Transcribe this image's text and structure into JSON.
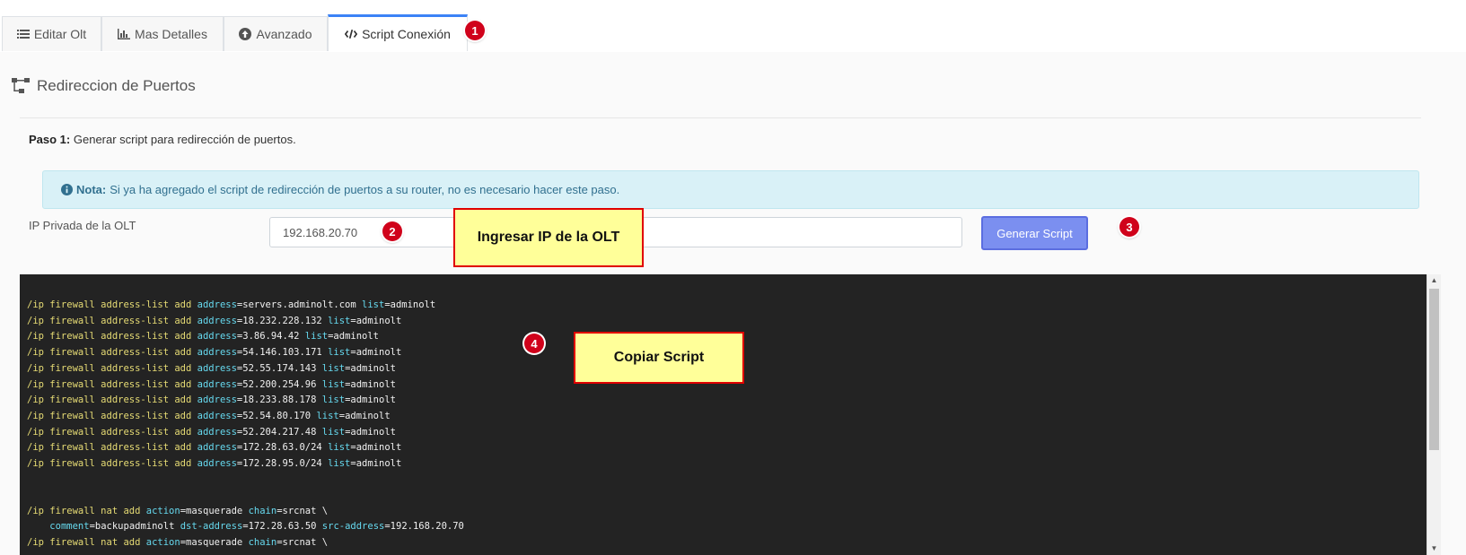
{
  "tabs": [
    {
      "label": "Editar Olt",
      "icon": "list-icon",
      "active": false
    },
    {
      "label": "Mas Detalles",
      "icon": "chart-icon",
      "active": false
    },
    {
      "label": "Avanzado",
      "icon": "arrow-up-circle-icon",
      "active": false
    },
    {
      "label": "Script Conexión",
      "icon": "code-icon",
      "active": true
    }
  ],
  "section": {
    "title": "Redireccion de Puertos",
    "icon": "sitemap-icon"
  },
  "step": {
    "label": "Paso 1:",
    "text": "Generar script para redirección de puertos."
  },
  "note": {
    "label": "Nota:",
    "text": "Si ya ha agregado el script de redirección de puertos a su router, no es necesario hacer este paso.",
    "icon": "info-icon"
  },
  "ip": {
    "label": "IP Privada de la OLT",
    "value": "192.168.20.70"
  },
  "generate_button": {
    "label": "Generar Script",
    "color": "#7b8ff0"
  },
  "callouts": {
    "ip": "Ingresar IP de la OLT",
    "copy": "Copiar Script"
  },
  "badges": [
    "1",
    "2",
    "3",
    "4"
  ],
  "script": {
    "address_lines": [
      {
        "cmd": "/ip firewall address-list add",
        "address": "servers.adminolt.com",
        "list": "adminolt"
      },
      {
        "cmd": "/ip firewall address-list add",
        "address": "18.232.228.132",
        "list": "adminolt"
      },
      {
        "cmd": "/ip firewall address-list add",
        "address": "3.86.94.42",
        "list": "adminolt"
      },
      {
        "cmd": "/ip firewall address-list add",
        "address": "54.146.103.171",
        "list": "adminolt"
      },
      {
        "cmd": "/ip firewall address-list add",
        "address": "52.55.174.143",
        "list": "adminolt"
      },
      {
        "cmd": "/ip firewall address-list add",
        "address": "52.200.254.96",
        "list": "adminolt"
      },
      {
        "cmd": "/ip firewall address-list add",
        "address": "18.233.88.178",
        "list": "adminolt"
      },
      {
        "cmd": "/ip firewall address-list add",
        "address": "52.54.80.170",
        "list": "adminolt"
      },
      {
        "cmd": "/ip firewall address-list add",
        "address": "52.204.217.48",
        "list": "adminolt"
      },
      {
        "cmd": "/ip firewall address-list add",
        "address": "172.28.63.0/24",
        "list": "adminolt"
      },
      {
        "cmd": "/ip firewall address-list add",
        "address": "172.28.95.0/24",
        "list": "adminolt"
      }
    ],
    "nat1_cmd": "/ip firewall nat add",
    "nat1_action": "masquerade",
    "nat1_chain": "srcnat \\",
    "nat1_comment": "backupadminolt",
    "nat1_dst": "172.28.63.50",
    "nat1_src": "192.168.20.70",
    "nat2_cmd": "/ip firewall nat add",
    "nat2_action": "masquerade",
    "nat2_chain": "srcnat \\"
  },
  "colors": {
    "keyword": "#e6db74",
    "attribute": "#66d9ef",
    "code_bg": "#232323",
    "badge": "#d0021b",
    "callout_bg": "#ffff99"
  }
}
